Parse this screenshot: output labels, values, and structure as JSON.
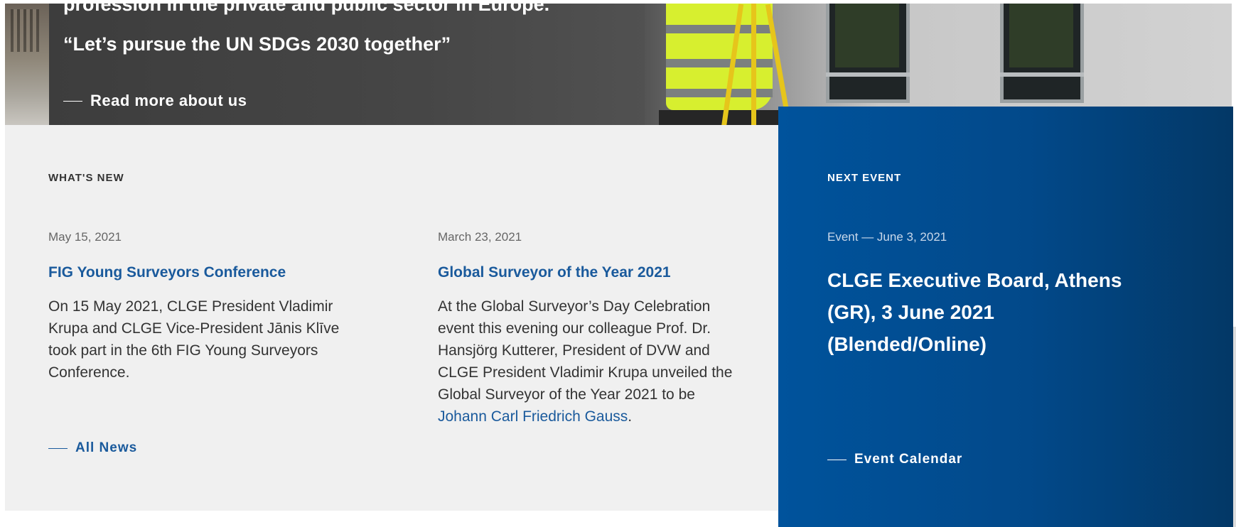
{
  "hero": {
    "top_text": "profession in the private and public sector in Europe.",
    "quote": "“Let’s pursue the UN SDGs 2030 together”",
    "link_label": "Read more about us"
  },
  "whats_new": {
    "heading": "WHAT'S NEW",
    "articles": [
      {
        "date": "May 15, 2021",
        "title": "FIG Young Surveyors Conference",
        "body": "On 15 May 2021, CLGE President Vladimir Krupa and CLGE Vice-President Jānis Klīve took part in the 6th FIG Young Surveyors Conference."
      },
      {
        "date": "March 23, 2021",
        "title": "Global Surveyor of the Year 2021",
        "body": "At the Global Surveyor’s Day Celebration event this evening our colleague Prof. Dr. Hansjörg Kutterer, President of DVW and CLGE President Vladimir Krupa unveiled the Global Surveyor of the Year 2021 to be ",
        "body_link": "Johann Carl Friedrich Gauss",
        "body_end": "."
      }
    ],
    "all_news_label": "All News"
  },
  "next_event": {
    "heading": "NEXT EVENT",
    "meta": "Event — June 3, 2021",
    "title": "CLGE Executive Board, Athens (GR), 3 June 2021 (Blended/Online)",
    "calendar_label": "Event Calendar"
  },
  "colors": {
    "link_blue": "#1a5a9c",
    "event_blue": "#00539c",
    "news_bg": "#f0f0f0"
  }
}
